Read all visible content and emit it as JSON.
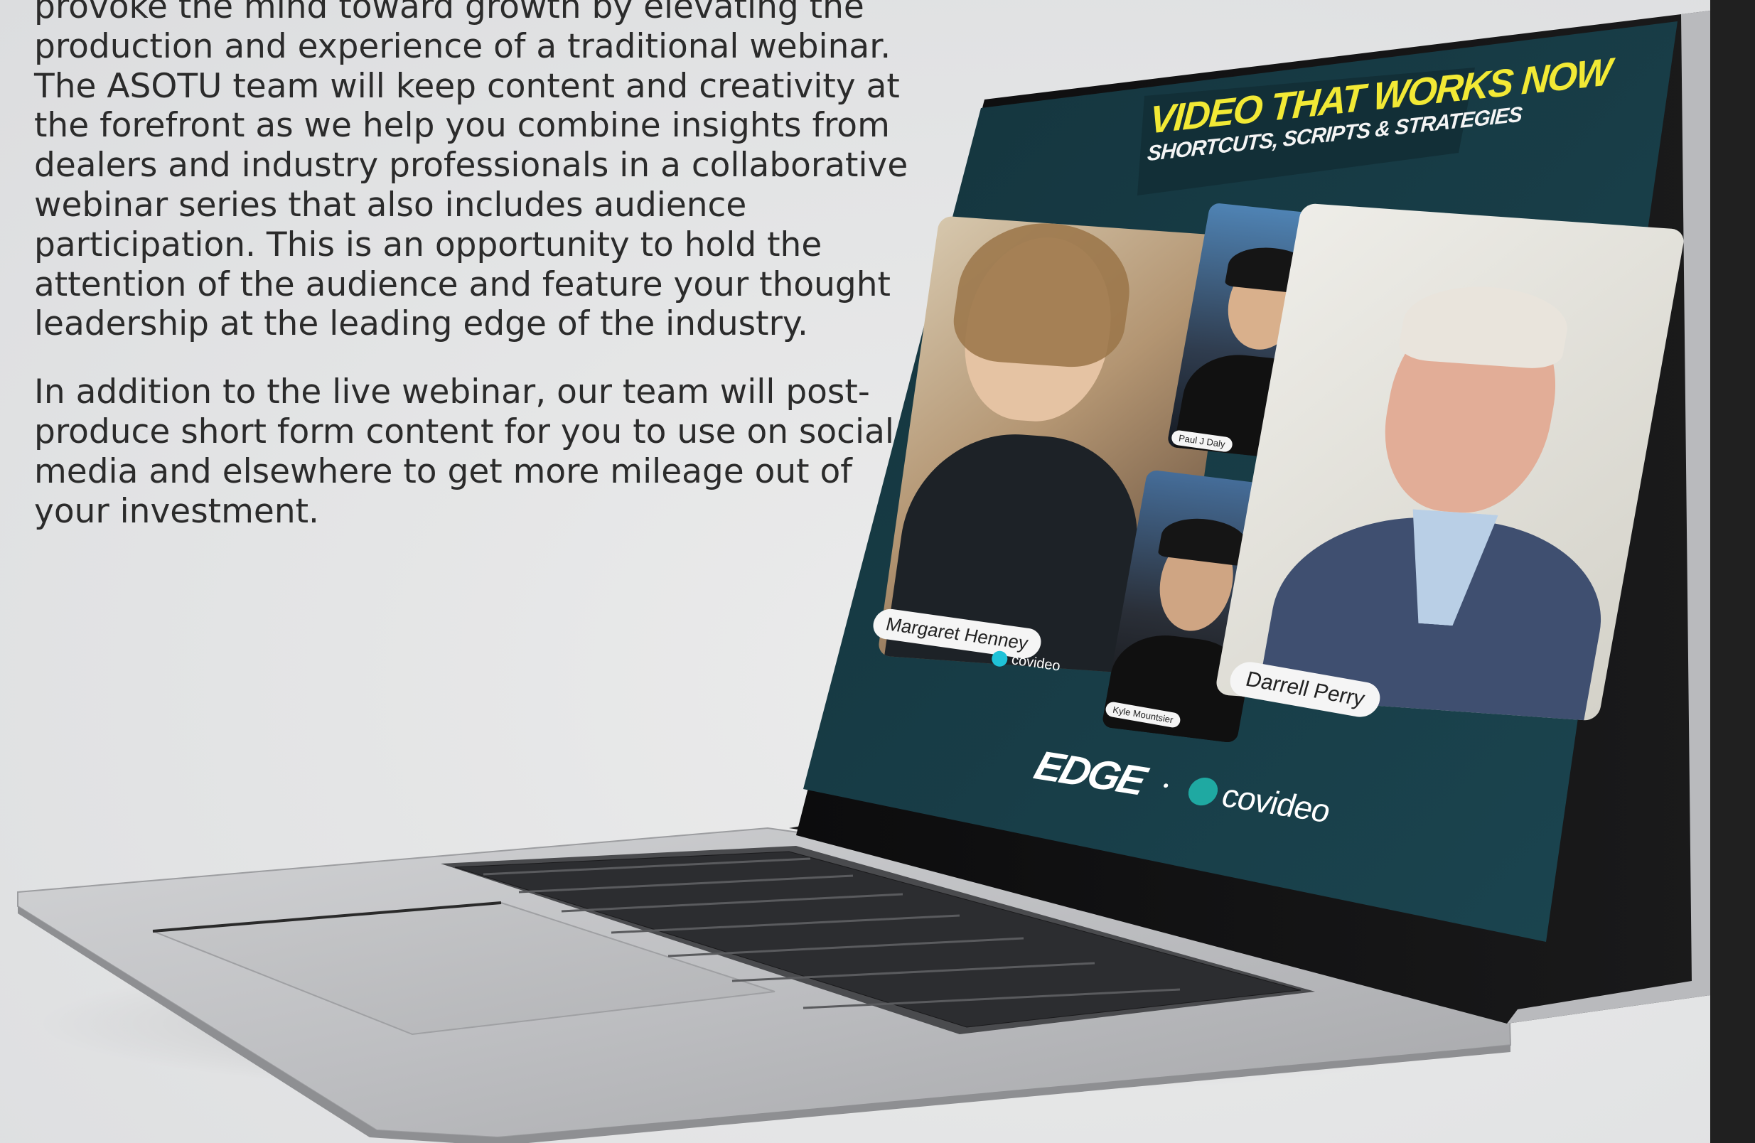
{
  "article": {
    "paragraph_1": "provoke the mind toward growth by elevating the production and experience of a traditional webinar. The ASOTU team will keep content and creativity at the forefront as we help you combine insights from dealers and industry professionals in a collaborative webinar series that also includes audience participation. This is an opportunity to hold the attention of the audience and feature your thought leadership at the leading edge of the industry.",
    "paragraph_2": "In addition to the live webinar, our team will post-produce short form content for you to use on social media and elsewhere to get more mileage out of your investment."
  },
  "webinar": {
    "title_line_1": "VIDEO THAT WORKS NOW",
    "title_line_2": "SHORTCUTS, SCRIPTS & STRATEGIES",
    "speakers": [
      {
        "name": "Margaret Henney"
      },
      {
        "name": "Paul J Daly"
      },
      {
        "name": "Kyle Mountsier"
      },
      {
        "name": "Darrell Perry"
      }
    ],
    "watermark": "covideo",
    "sponsor_logo_1": "EDGE",
    "sponsor_logo_2": "covideo"
  },
  "colors": {
    "page_background": "#e4e5e6",
    "body_text": "#2b2b2b",
    "screen_background": "#163a44",
    "title_yellow": "#f2e935",
    "right_bar": "#202020"
  }
}
